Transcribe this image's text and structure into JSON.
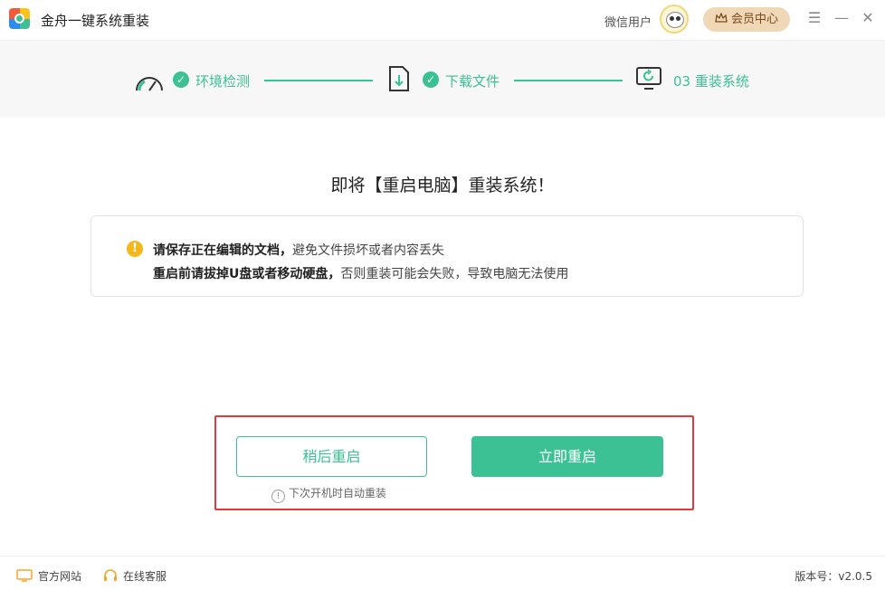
{
  "titlebar": {
    "app_title": "金舟一键系统重装",
    "user_label": "微信用户",
    "vip_label": "会员中心",
    "menu_glyph": "☰",
    "minimize_glyph": "—",
    "close_glyph": "✕"
  },
  "steps": [
    {
      "label": "环境检测",
      "status": "done",
      "icon": "gauge-icon"
    },
    {
      "label": "下载文件",
      "status": "done",
      "icon": "download-file-icon"
    },
    {
      "label": "03 重装系统",
      "status": "current",
      "icon": "monitor-refresh-icon"
    }
  ],
  "main": {
    "heading": "即将【重启电脑】重装系统！",
    "notice": {
      "line1_bold": "请保存正在编辑的文档，",
      "line1_normal": "避免文件损坏或者内容丢失",
      "line2_bold": "重启前请拔掉U盘或者移动硬盘，",
      "line2_normal": "否则重装可能会失败，导致电脑无法使用"
    },
    "later_button": "稍后重启",
    "now_button": "立即重启",
    "hint": "下次开机时自动重装"
  },
  "footer": {
    "website": "官方网站",
    "support": "在线客服",
    "version": "版本号：v2.0.5"
  },
  "colors": {
    "accent": "#3cc195",
    "warning": "#f5b81c",
    "vip_bg": "#f0d7b5",
    "highlight_frame": "#e23a3a"
  }
}
